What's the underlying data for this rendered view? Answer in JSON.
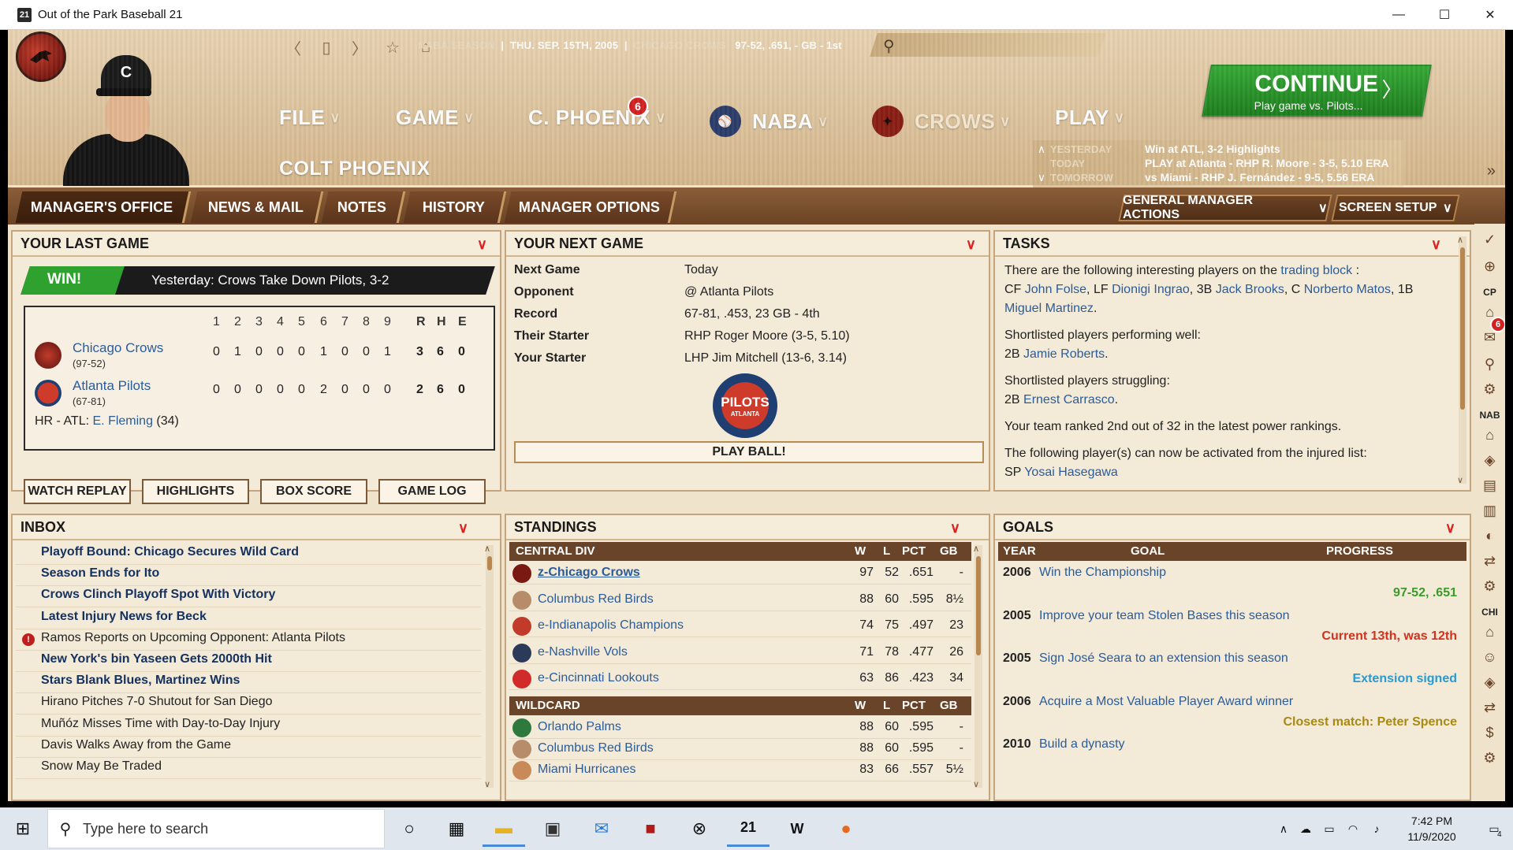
{
  "window": {
    "app_icon": "21",
    "title": "Out of the Park Baseball 21",
    "minimize": "—",
    "maximize": "☐",
    "close": "✕"
  },
  "header": {
    "player_cap_letter": "C",
    "season": "NABA SEASON",
    "date": "THU. SEP. 15TH, 2005",
    "team": "CHICAGO CROWS",
    "record": "97-52, .651, - GB - 1st",
    "menus": {
      "file": "FILE",
      "game": "GAME",
      "manager": "C. PHOENIX",
      "manager_badge": "6",
      "league": "NABA",
      "team": "CROWS",
      "play": "PLAY"
    },
    "manager_name": "COLT PHOENIX",
    "continue": {
      "label": "CONTINUE",
      "sub": "Play game vs. Pilots..."
    },
    "schedule": {
      "yesterday_key": "YESTERDAY",
      "yesterday_val": "Win at ATL, 3-2     Highlights",
      "today_key": "TODAY",
      "today_val": "PLAY at Atlanta - RHP R. Moore - 3-5, 5.10 ERA",
      "tomorrow_key": "TOMORROW",
      "tomorrow_val": "vs Miami - RHP J. Fernández - 9-5, 5.56 ERA"
    }
  },
  "tabs": {
    "managers_office": "MANAGER'S OFFICE",
    "news_mail": "NEWS & MAIL",
    "notes": "NOTES",
    "history": "HISTORY",
    "manager_options": "MANAGER OPTIONS",
    "gm_actions": "GENERAL MANAGER ACTIONS",
    "screen_setup": "SCREEN SETUP"
  },
  "last_game": {
    "title": "YOUR LAST GAME",
    "result": "WIN!",
    "headline": "Yesterday: Crows Take Down Pilots, 3-2",
    "innings": [
      "1",
      "2",
      "3",
      "4",
      "5",
      "6",
      "7",
      "8",
      "9"
    ],
    "rhe": [
      "R",
      "H",
      "E"
    ],
    "teams": [
      {
        "name": "Chicago Crows",
        "record": "(97-52)",
        "line": [
          "0",
          "1",
          "0",
          "0",
          "0",
          "1",
          "0",
          "0",
          "1"
        ],
        "rhe": [
          "3",
          "6",
          "0"
        ]
      },
      {
        "name": "Atlanta Pilots",
        "record": "(67-81)",
        "line": [
          "0",
          "0",
          "0",
          "0",
          "0",
          "2",
          "0",
          "0",
          "0"
        ],
        "rhe": [
          "2",
          "6",
          "0"
        ]
      }
    ],
    "hr_prefix": "HR - ATL: ",
    "hr_player": "E. Fleming",
    "hr_count": " (34)",
    "buttons": {
      "replay": "WATCH REPLAY",
      "highlights": "HIGHLIGHTS",
      "boxscore": "BOX SCORE",
      "gamelog": "GAME LOG"
    }
  },
  "next_game": {
    "title": "YOUR NEXT GAME",
    "rows": [
      {
        "key": "Next Game",
        "val": "Today"
      },
      {
        "key": "Opponent",
        "val": "@ Atlanta Pilots"
      },
      {
        "key": "Record",
        "val": "67-81, .453, 23 GB - 4th"
      },
      {
        "key": "Their Starter",
        "val": "RHP Roger Moore (3-5, 5.10)"
      },
      {
        "key": "Your Starter",
        "val": "LHP Jim Mitchell (13-6, 3.14)"
      }
    ],
    "logo_text": "PILOTS",
    "logo_sub": "ATLANTA",
    "play_ball": "PLAY BALL!"
  },
  "tasks": {
    "title": "TASKS",
    "p1_pre": "There are the following interesting players on the ",
    "p1_link": "trading block",
    "p1_post": " :",
    "p1_list_a": "CF ",
    "p1_n1": "John Folse",
    "p1_b": ", LF ",
    "p1_n2": "Dionigi Ingrao",
    "p1_c": ", 3B ",
    "p1_n3": "Jack Brooks",
    "p1_d": ", C ",
    "p1_n4": "Norberto Matos",
    "p1_e": ", 1B",
    "p1_n5": "Miguel Martinez",
    "p1_f": ".",
    "p2_pre": "Shortlisted players performing well:",
    "p2_pos": "2B ",
    "p2_name": "Jamie Roberts",
    "p2_dot": ".",
    "p3_pre": "Shortlisted players struggling:",
    "p3_pos": "2B ",
    "p3_name": "Ernest Carrasco",
    "p3_dot": ".",
    "p4": "Your team ranked 2nd out of 32 in the latest power rankings.",
    "p5_pre": "The following player(s) can now be activated from the injured list:",
    "p5_pos": "SP ",
    "p5_name": "Yosai Hasegawa"
  },
  "inbox": {
    "title": "INBOX",
    "items": [
      {
        "text": "Playoff Bound: Chicago Secures Wild Card",
        "unread": true,
        "alert": false
      },
      {
        "text": "Season Ends for Ito",
        "unread": true,
        "alert": false
      },
      {
        "text": "Crows Clinch Playoff Spot With Victory",
        "unread": true,
        "alert": false
      },
      {
        "text": "Latest Injury News for Beck",
        "unread": true,
        "alert": false
      },
      {
        "text": "Ramos Reports on Upcoming Opponent: Atlanta Pilots",
        "unread": false,
        "alert": true
      },
      {
        "text": "New York's bin Yaseen Gets 2000th Hit",
        "unread": true,
        "alert": false
      },
      {
        "text": "Stars Blank Blues, Martinez Wins",
        "unread": true,
        "alert": false
      },
      {
        "text": "Hirano Pitches 7-0 Shutout for San Diego",
        "unread": false,
        "alert": false
      },
      {
        "text": "Muñóz Misses Time with Day-to-Day Injury",
        "unread": false,
        "alert": false
      },
      {
        "text": "Davis Walks Away from the Game",
        "unread": false,
        "alert": false
      },
      {
        "text": "Snow May Be Traded",
        "unread": false,
        "alert": false
      }
    ]
  },
  "standings": {
    "title": "STANDINGS",
    "div_name": "CENTRAL DIV",
    "wc_name": "WILDCARD",
    "cols": [
      "W",
      "L",
      "PCT",
      "GB"
    ],
    "division": [
      {
        "team": "z-Chicago Crows",
        "w": "97",
        "l": "52",
        "pct": ".651",
        "gb": "-",
        "logo": "#7a1912"
      },
      {
        "team": "Columbus Red Birds",
        "w": "88",
        "l": "60",
        "pct": ".595",
        "gb": "8½",
        "logo": "#b78c6a"
      },
      {
        "team": "e-Indianapolis Champions",
        "w": "74",
        "l": "75",
        "pct": ".497",
        "gb": "23",
        "logo": "#c23b2a"
      },
      {
        "team": "e-Nashville Vols",
        "w": "71",
        "l": "78",
        "pct": ".477",
        "gb": "26",
        "logo": "#2c3a5a"
      },
      {
        "team": "e-Cincinnati Lookouts",
        "w": "63",
        "l": "86",
        "pct": ".423",
        "gb": "34",
        "logo": "#d02a2a"
      }
    ],
    "wildcard": [
      {
        "team": "Orlando Palms",
        "w": "88",
        "l": "60",
        "pct": ".595",
        "gb": "-",
        "logo": "#2e7a3e"
      },
      {
        "team": "Columbus Red Birds",
        "w": "88",
        "l": "60",
        "pct": ".595",
        "gb": "-",
        "logo": "#b78c6a"
      },
      {
        "team": "Miami Hurricanes",
        "w": "83",
        "l": "66",
        "pct": ".557",
        "gb": "5½",
        "logo": "#c98a5a"
      }
    ]
  },
  "goals": {
    "title": "GOALS",
    "cols": {
      "year": "YEAR",
      "goal": "GOAL",
      "progress": "PROGRESS"
    },
    "rows": [
      {
        "year": "2006",
        "goal": "Win the Championship",
        "progress": "97-52, .651",
        "color": "#3a9a2a"
      },
      {
        "year": "2005",
        "goal": "Improve your team Stolen Bases this season",
        "progress": "Current 13th, was 12th",
        "color": "#d2321e"
      },
      {
        "year": "2005",
        "goal": "Sign José Seara to an extension this season",
        "progress": "Extension signed",
        "color": "#2a9ad2"
      },
      {
        "year": "2006",
        "goal": "Acquire a Most Valuable Player Award winner",
        "progress": "Closest match: Peter Spence",
        "color": "#a88a12"
      },
      {
        "year": "2010",
        "goal": "Build a dynasty",
        "progress": "",
        "color": "#222"
      }
    ]
  },
  "rail": {
    "cp": "CP",
    "nab": "NAB",
    "chi": "CHI",
    "badge": "6"
  },
  "taskbar": {
    "search_placeholder": "Type here to search",
    "time": "7:42 PM",
    "date": "11/9/2020",
    "notif_count": "4"
  }
}
